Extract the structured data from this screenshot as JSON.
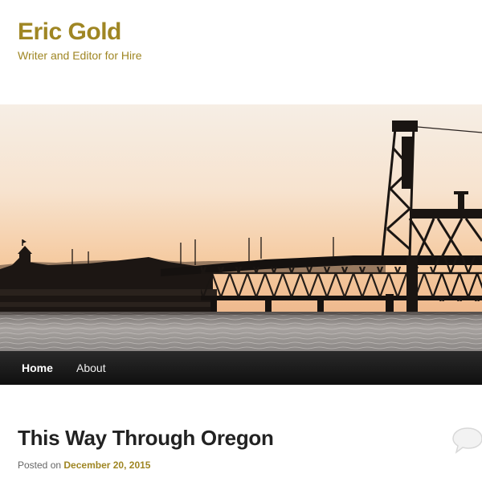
{
  "site": {
    "title": "Eric Gold",
    "description": "Writer and Editor for Hire"
  },
  "nav": {
    "items": [
      {
        "label": "Home",
        "current": true
      },
      {
        "label": "About",
        "current": false
      }
    ]
  },
  "post": {
    "title": "This Way Through Oregon",
    "posted_on_label": "Posted on",
    "date": "December 20, 2015"
  },
  "colors": {
    "accent": "#9f8623",
    "nav_bg": "#1a1a1a",
    "title_text": "#222222"
  },
  "icons": {
    "comment": "comment-bubble-icon"
  }
}
